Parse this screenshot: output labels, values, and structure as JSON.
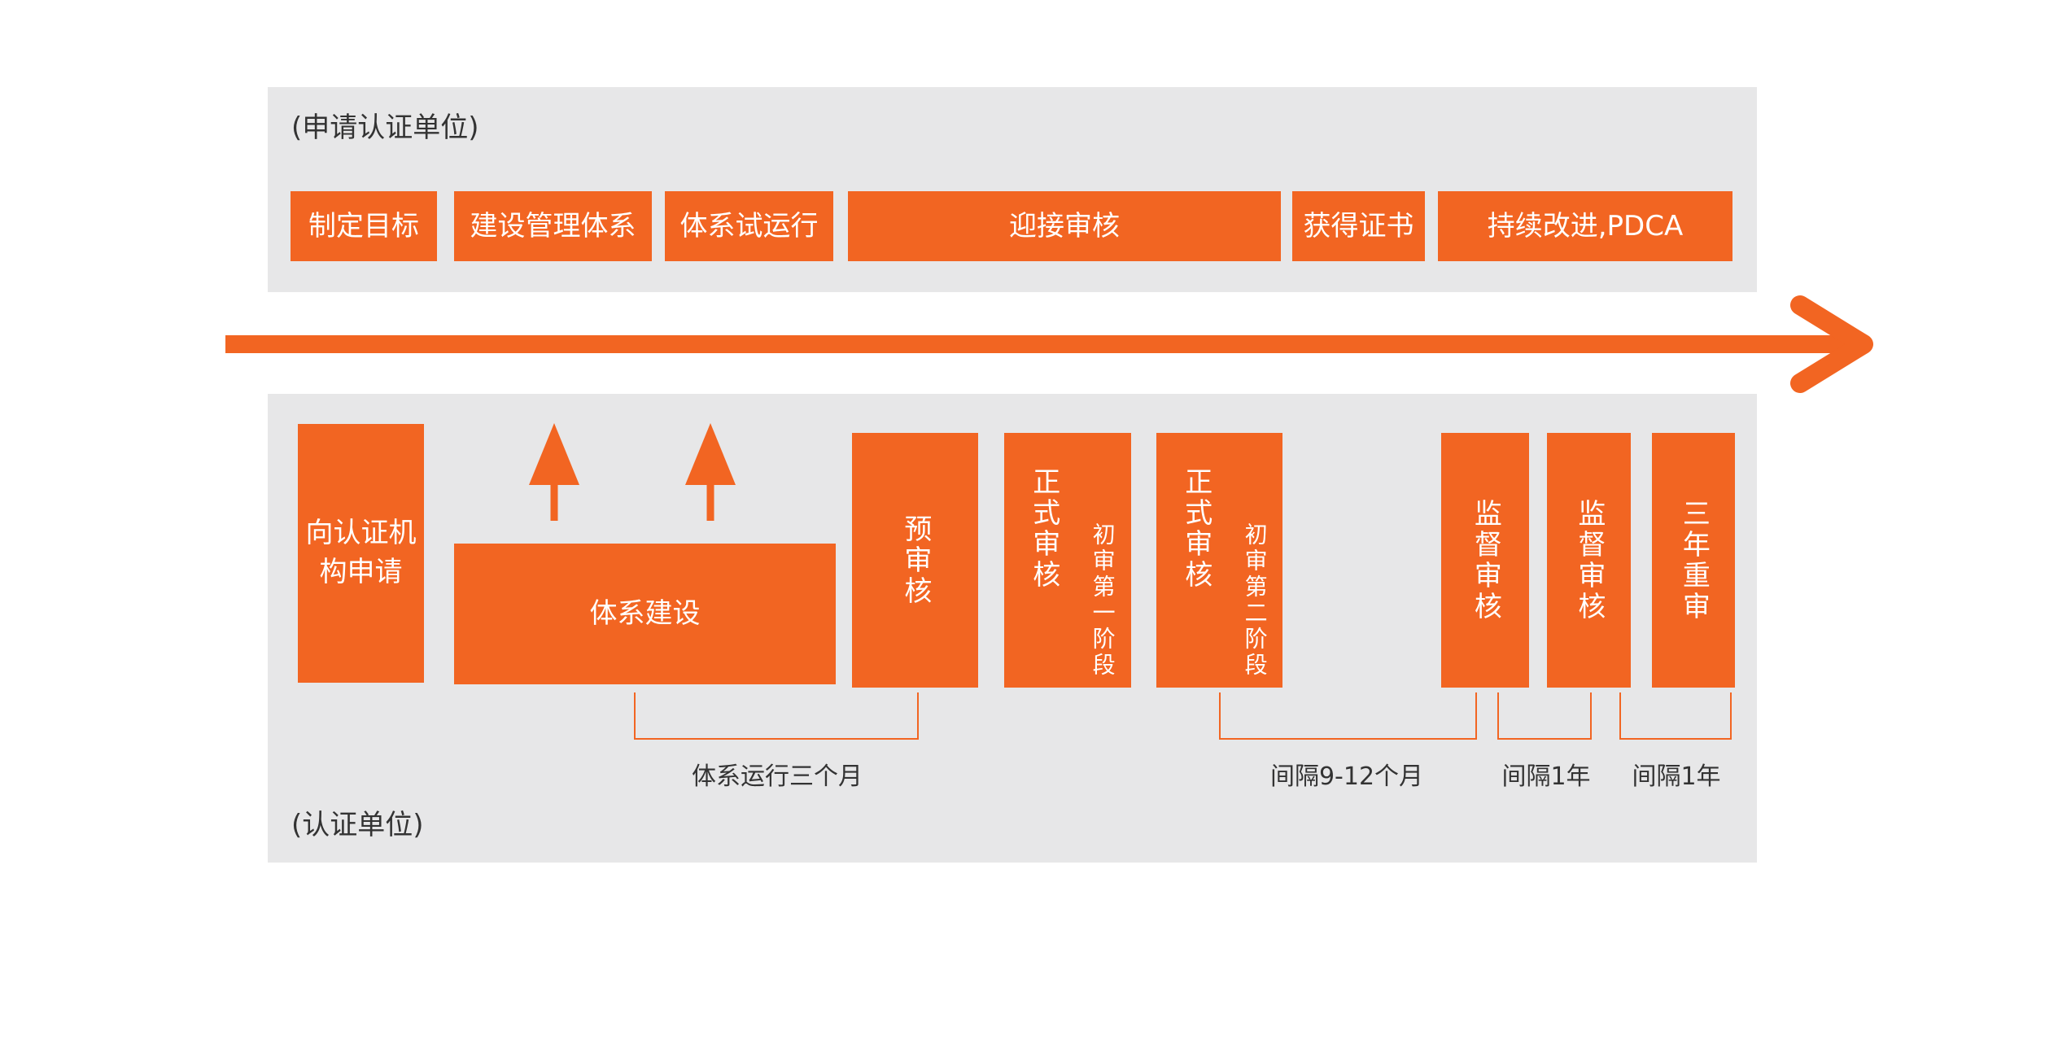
{
  "applicant": {
    "caption": "(申请认证单位)",
    "steps": [
      {
        "label": "制定目标"
      },
      {
        "label": "建设管理体系"
      },
      {
        "label": "体系试运行"
      },
      {
        "label": "迎接审核"
      },
      {
        "label": "获得证书"
      },
      {
        "label": "持续改进,PDCA"
      }
    ]
  },
  "certifier": {
    "caption": "(认证单位)",
    "apply": "向认证机构申请",
    "system_build": "体系建设",
    "pre_audit": "预审核",
    "formal_audit_1": {
      "main": "正式审核",
      "sub": "初审第一阶段"
    },
    "formal_audit_2": {
      "main": "正式审核",
      "sub": "初审第二阶段"
    },
    "surveillance_1": "监督审核",
    "surveillance_2": "监督审核",
    "recertification": "三年重审"
  },
  "intervals": {
    "run_period": "体系运行三个月",
    "gap_9_12": "间隔9-12个月",
    "gap_1y_a": "间隔1年",
    "gap_1y_b": "间隔1年"
  },
  "colors": {
    "accent": "#f26522",
    "panel": "#e7e7e8",
    "text": "#333333"
  }
}
